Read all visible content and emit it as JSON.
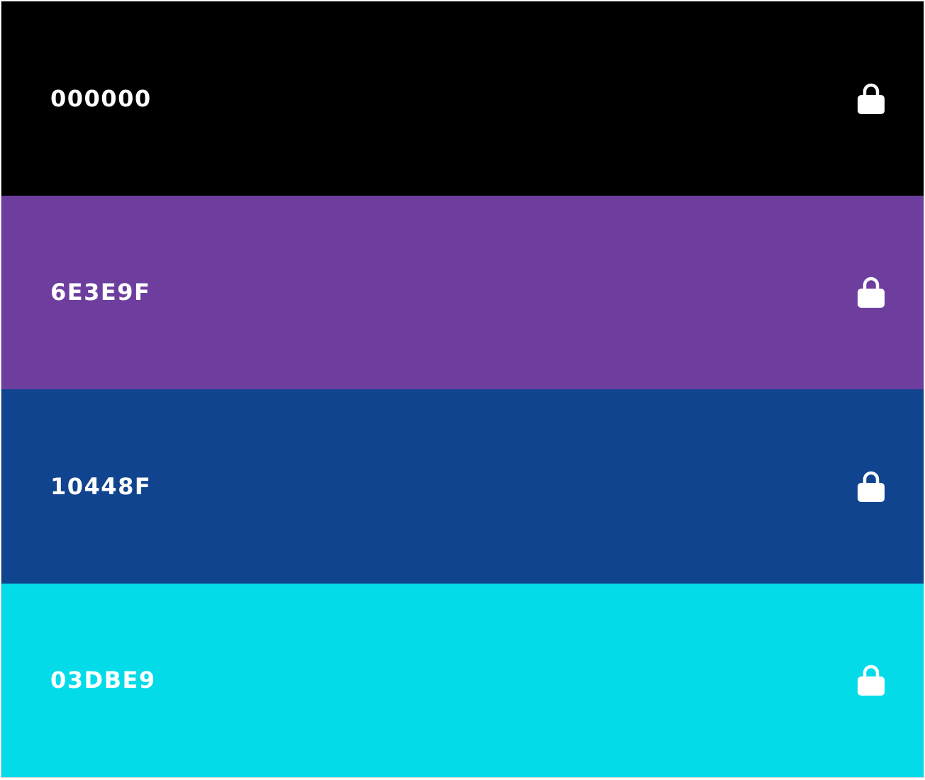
{
  "palette": {
    "swatches": [
      {
        "hex": "000000",
        "color": "#000000",
        "locked": true,
        "lock_icon": "lock-icon"
      },
      {
        "hex": "6E3E9F",
        "color": "#6E3E9F",
        "locked": true,
        "lock_icon": "lock-icon"
      },
      {
        "hex": "10448F",
        "color": "#10448F",
        "locked": true,
        "lock_icon": "lock-icon"
      },
      {
        "hex": "03DBE9",
        "color": "#03DBE9",
        "locked": true,
        "lock_icon": "lock-icon"
      }
    ]
  }
}
